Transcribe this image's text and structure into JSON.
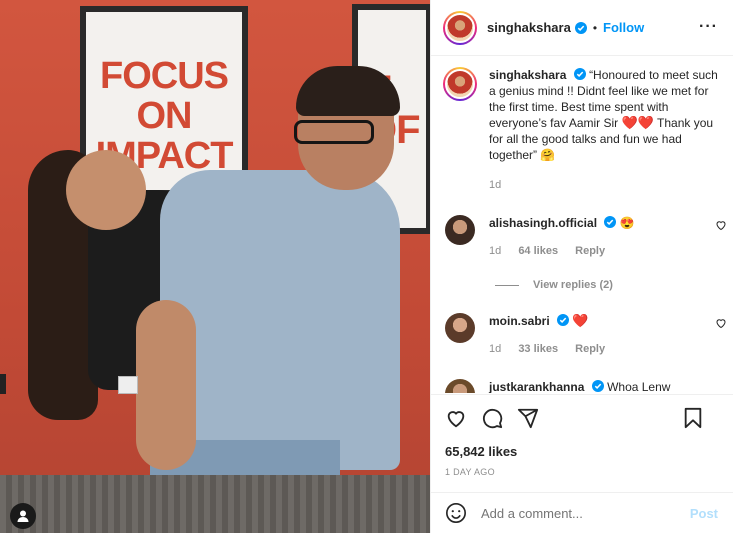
{
  "photo": {
    "poster1_text": "FOCUS ON IMPACT",
    "poster2_text": "E OF"
  },
  "header": {
    "username": "singhakshara",
    "separator": "•",
    "follow_label": "Follow",
    "more_label": "···"
  },
  "caption": {
    "username": "singhakshara",
    "text_part1": "“Honoured to meet such a genius mind !! Didnt feel like we met for the first time. Best time spent with everyone’s fav Aamir Sir",
    "hearts": "❤️❤️",
    "text_part2": "Thank you for all the good talks and fun we had together”",
    "emoji_end": "🤗",
    "age": "1d"
  },
  "comments": [
    {
      "username": "alishasingh.official",
      "text": "😍",
      "age": "1d",
      "likes": "64 likes",
      "reply": "Reply"
    },
    {
      "username": "moin.sabri",
      "text": "❤️",
      "age": "1d",
      "likes": "33 likes",
      "reply": "Reply"
    },
    {
      "username": "justkarankhanna",
      "text": "Whoa Lenw",
      "age": "",
      "likes": "",
      "reply": ""
    }
  ],
  "view_replies": "View replies (2)",
  "likes_count": "65,842 likes",
  "time_ago": "1 DAY AGO",
  "add_comment": {
    "placeholder": "Add a comment...",
    "post_label": "Post"
  },
  "colors": {
    "accent": "#0095f6",
    "post_disabled": "#b2dffc",
    "heart": "#ed1c24",
    "wall": "#c9503c"
  },
  "icons": [
    "verified-badge-icon",
    "heart-icon",
    "comment-icon",
    "share-icon",
    "bookmark-icon",
    "emoji-icon",
    "user-tag-icon"
  ]
}
